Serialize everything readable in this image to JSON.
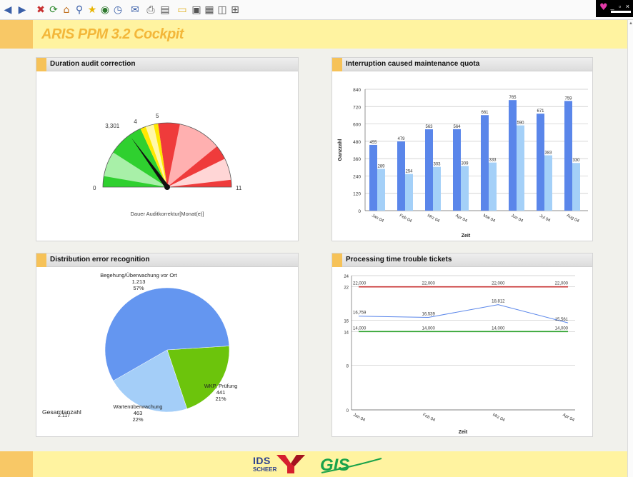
{
  "app": {
    "title": "ARIS PPM 3.2 Cockpit"
  },
  "toolbar": {
    "icons": [
      "back-icon",
      "forward-icon",
      "stop-icon",
      "refresh-icon",
      "home-icon",
      "search-icon",
      "favorites-icon",
      "media-icon",
      "history-icon",
      "mail-icon",
      "print-icon",
      "edit-icon",
      "discuss-icon",
      "folder-icon",
      "messenger-icon",
      "research-icon",
      "window-icon",
      "extra-icon"
    ]
  },
  "logos": {
    "ids": "IDS",
    "ids_sub": "SCHEER",
    "gis": "GIS"
  },
  "panels": {
    "gauge": {
      "title": "Duration audit correction"
    },
    "bars": {
      "title": "Interruption caused maintenance quota"
    },
    "pie": {
      "title": "Distribution error recognition"
    },
    "lines": {
      "title": "Processing time trouble tickets"
    }
  },
  "chart_data": [
    {
      "type": "gauge",
      "xlabel": "Dauer Auditkorrektur[Monat(e)]",
      "min": 0,
      "max": 11,
      "value": 3.301,
      "value_label": "3,301",
      "thresholds": [
        4,
        5
      ],
      "tick_labels": [
        "0",
        "4",
        "5",
        "11"
      ],
      "zone_colors": {
        "good": "#2fd02f",
        "warn": "#ffe800",
        "bad": "#ef3b3b"
      }
    },
    {
      "type": "bar",
      "categories": [
        "Jan 04",
        "Feb 04",
        "Mrz 04",
        "Apr 04",
        "Mai 04",
        "Jun 04",
        "Jul 04",
        "Aug 04"
      ],
      "series": [
        {
          "values": [
            455,
            479,
            563,
            564,
            661,
            765,
            671,
            759
          ],
          "color": "#5a86ea"
        },
        {
          "values": [
            289,
            254,
            303,
            309,
            333,
            590,
            383,
            330
          ],
          "color": "#a4d0f8"
        }
      ],
      "xlabel": "Zeit",
      "ylabel": "Ganzzahl",
      "ylim": [
        0,
        840
      ],
      "yticks": [
        0,
        120,
        240,
        360,
        480,
        600,
        720,
        840
      ]
    },
    {
      "type": "pie",
      "slices": [
        {
          "label": "Begehung/Überwachung vor Ort",
          "value": 1213,
          "value_label": "1.213",
          "percent": "57%",
          "color": "#6496f0"
        },
        {
          "label": "WKP, Prüfung",
          "value": 441,
          "value_label": "441",
          "percent": "21%",
          "color": "#6cc40c"
        },
        {
          "label": "Wartenüberwachung",
          "value": 463,
          "value_label": "463",
          "percent": "22%",
          "color": "#a4cef8"
        }
      ],
      "total_label": "Gesamtanzahl",
      "total_value": "2.117"
    },
    {
      "type": "line",
      "categories": [
        "Jan 04",
        "Feb 04",
        "Mrz 04",
        "Apr 04"
      ],
      "series": [
        {
          "values": [
            22,
            22,
            22,
            22
          ],
          "labels": [
            "22,000",
            "22,000",
            "22,000",
            "22,000"
          ],
          "color": "#c83232"
        },
        {
          "values": [
            16.759,
            16.539,
            18.812,
            15.561
          ],
          "labels": [
            "16,759",
            "16,539",
            "18,812",
            "15,561"
          ],
          "color": "#5a86ea"
        },
        {
          "values": [
            14,
            14,
            14,
            14
          ],
          "labels": [
            "14,000",
            "14,000",
            "14,000",
            "14,000"
          ],
          "color": "#2aa02a"
        }
      ],
      "xlabel": "Zeit",
      "ylim": [
        0,
        24
      ],
      "yticks": [
        0,
        8,
        14,
        16,
        22,
        24
      ]
    }
  ]
}
